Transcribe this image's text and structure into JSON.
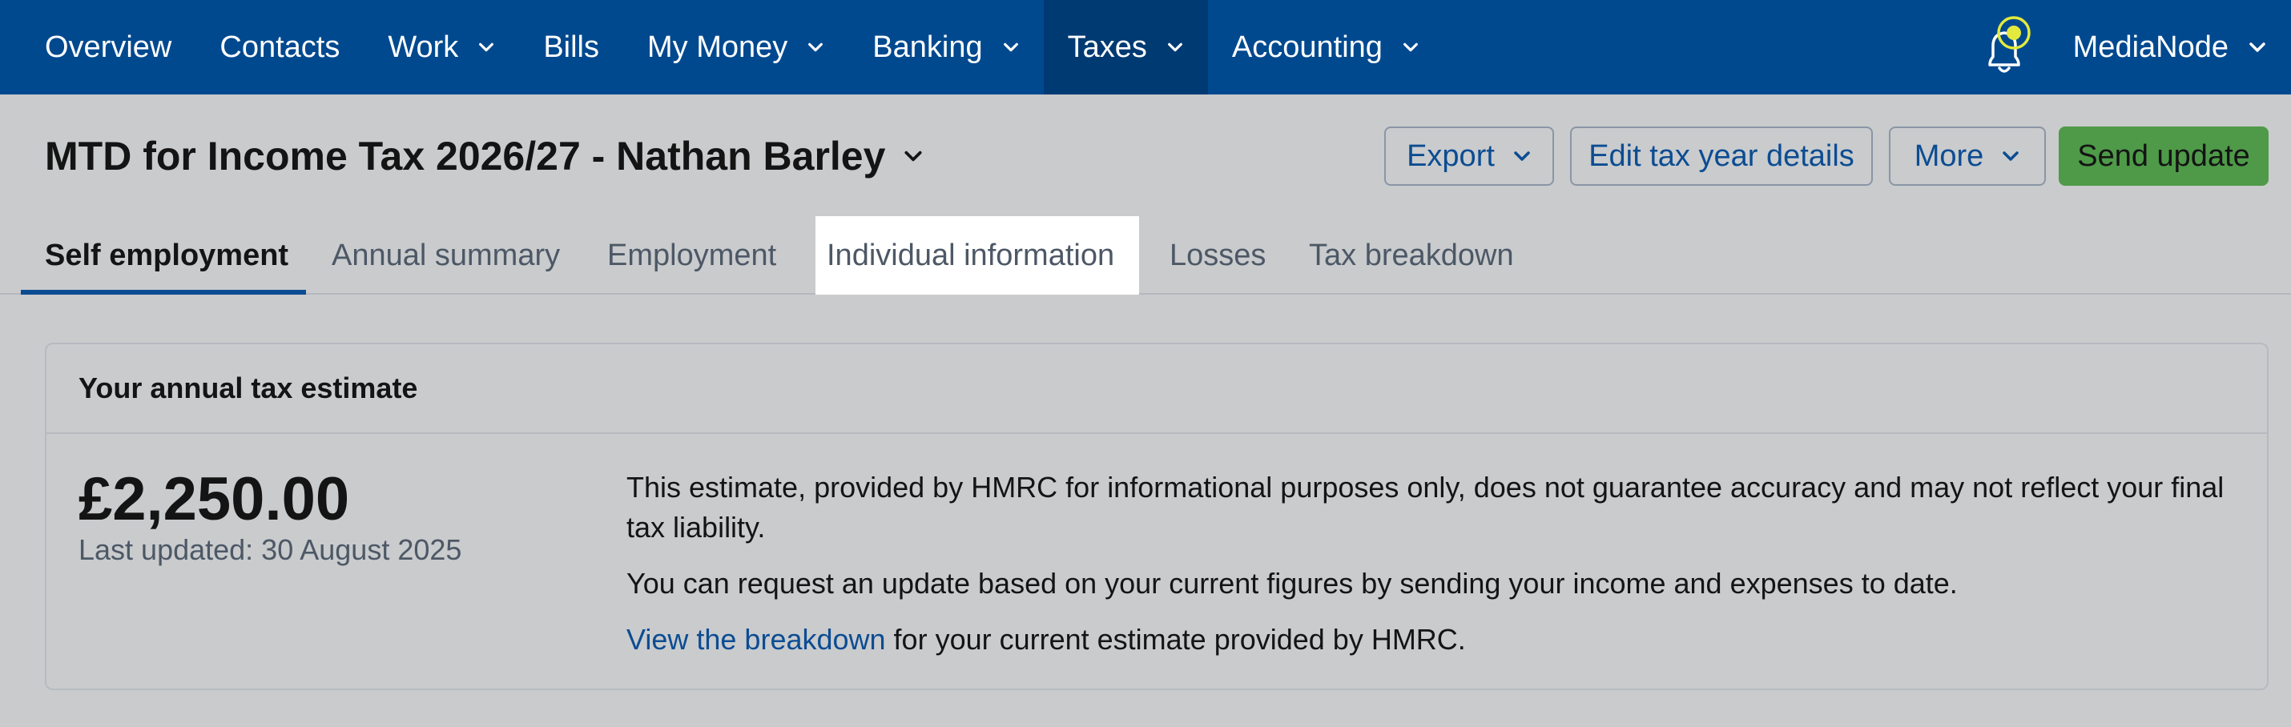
{
  "topnav": {
    "items": [
      {
        "label": "Overview",
        "has_dropdown": false,
        "active": false
      },
      {
        "label": "Contacts",
        "has_dropdown": false,
        "active": false
      },
      {
        "label": "Work",
        "has_dropdown": true,
        "active": false
      },
      {
        "label": "Bills",
        "has_dropdown": false,
        "active": false
      },
      {
        "label": "My Money",
        "has_dropdown": true,
        "active": false
      },
      {
        "label": "Banking",
        "has_dropdown": true,
        "active": false
      },
      {
        "label": "Taxes",
        "has_dropdown": true,
        "active": true
      },
      {
        "label": "Accounting",
        "has_dropdown": true,
        "active": false
      }
    ],
    "account_name": "MediaNode",
    "notification_icon": "bell-icon"
  },
  "page": {
    "title": "MTD for Income Tax 2026/27 - Nathan Barley"
  },
  "actions": {
    "export": "Export",
    "edit": "Edit tax year details",
    "more": "More",
    "send": "Send update"
  },
  "tabs": [
    {
      "label": "Self employment",
      "selected": true
    },
    {
      "label": "Annual summary",
      "selected": false
    },
    {
      "label": "Employment",
      "selected": false
    },
    {
      "label": "Individual information",
      "selected": false,
      "highlighted": true
    },
    {
      "label": "Losses",
      "selected": false
    },
    {
      "label": "Tax breakdown",
      "selected": false
    }
  ],
  "estimate": {
    "heading": "Your annual tax estimate",
    "amount": "£2,250.00",
    "last_updated": "Last updated: 30 August 2025",
    "disclaimer": "This estimate, provided by HMRC for informational purposes only, does not guarantee accuracy and may not reflect your final tax liability.",
    "request_text": "You can request an update based on your current figures by sending your income and expenses to date.",
    "breakdown_link": "View the breakdown",
    "breakdown_suffix": " for your current estimate provided by HMRC."
  },
  "colors": {
    "nav_bg": "#00498f",
    "nav_active": "#003a72",
    "link": "#0c4c92",
    "send_button": "#4e9a48",
    "page_bg": "#c9cbcd"
  }
}
